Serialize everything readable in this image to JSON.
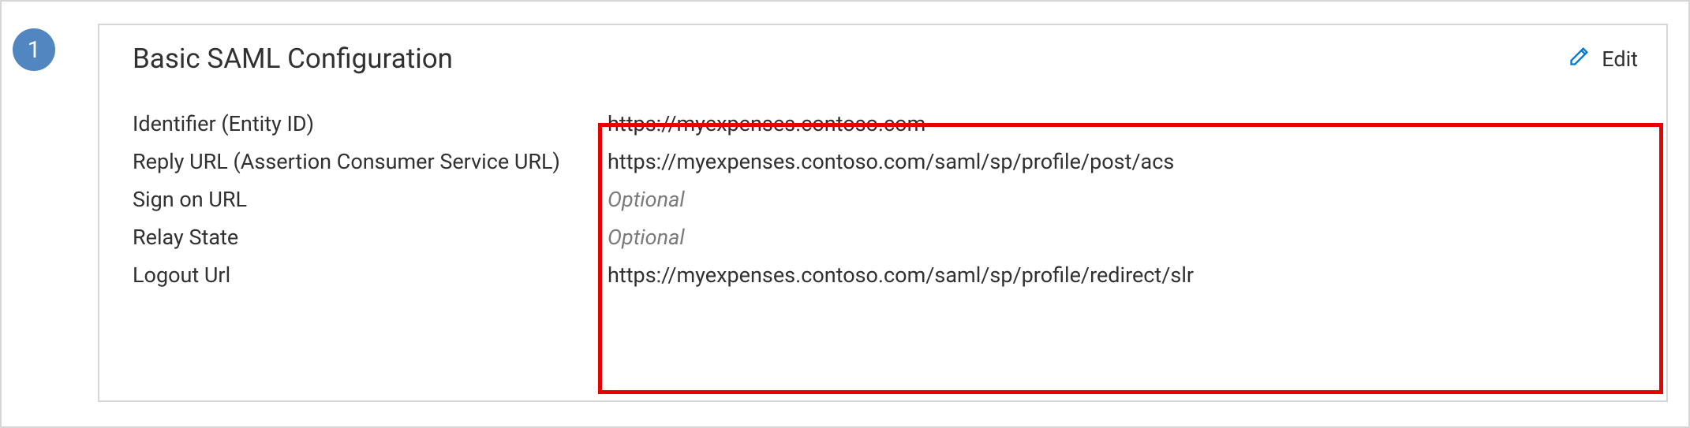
{
  "step": {
    "number": "1"
  },
  "card": {
    "title": "Basic SAML Configuration",
    "edit_label": "Edit"
  },
  "fields": {
    "identifier": {
      "label": "Identifier (Entity ID)",
      "value": "https://myexpenses.contoso.com",
      "optional": false
    },
    "reply_url": {
      "label": "Reply URL (Assertion Consumer Service URL)",
      "value": "https://myexpenses.contoso.com/saml/sp/profile/post/acs",
      "optional": false
    },
    "sign_on_url": {
      "label": "Sign on URL",
      "value": "Optional",
      "optional": true
    },
    "relay_state": {
      "label": "Relay State",
      "value": "Optional",
      "optional": true
    },
    "logout_url": {
      "label": "Logout Url",
      "value": "https://myexpenses.contoso.com/saml/sp/profile/redirect/slr",
      "optional": false
    }
  }
}
